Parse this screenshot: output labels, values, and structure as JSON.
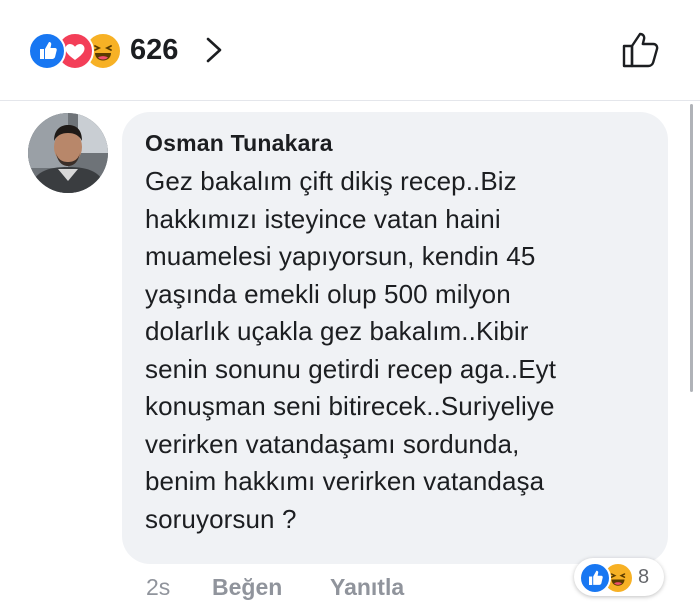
{
  "reactions_summary": {
    "icons": [
      "like-icon",
      "love-icon",
      "haha-icon"
    ],
    "count": "626",
    "chevron_icon": "chevron-right-icon",
    "like_button_icon": "thumbs-up-outline-icon"
  },
  "comment": {
    "author": "Osman Tunakara",
    "lines": [
      "Gez bakalım çift dikiş recep..Biz",
      "hakkımızı isteyince vatan haini",
      "muamelesi yapıyorsun, kendin 45",
      "yaşında emekli olup 500 milyon",
      "dolarlık uçakla gez bakalım..Kibir",
      "senin sonunu getirdi recep aga..Eyt",
      "konuşman seni bitirecek..Suriyeliye",
      "verirken vatandaşamı sordunda,",
      "benim hakkımı verirken vatandaşa",
      "soruyorsun ?"
    ],
    "time": "2s",
    "like_label": "Beğen",
    "reply_label": "Yanıtla",
    "reactions": {
      "icons": [
        "like-icon",
        "haha-icon"
      ],
      "count": "8"
    }
  },
  "colors": {
    "like_blue": "#1877f2",
    "love_red": "#f33e58",
    "haha_yellow": "#f7b125",
    "bubble_bg": "#f0f2f5",
    "meta_gray": "#90949c"
  }
}
